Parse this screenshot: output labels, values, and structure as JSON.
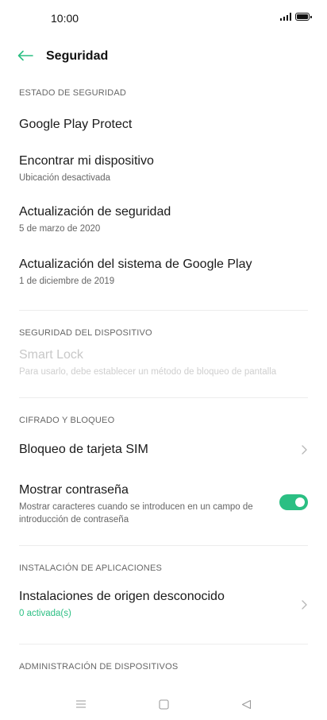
{
  "status": {
    "time": "10:00"
  },
  "header": {
    "title": "Seguridad"
  },
  "sections": {
    "security_status": {
      "header": "ESTADO DE SEGURIDAD",
      "items": [
        {
          "title": "Google Play Protect"
        },
        {
          "title": "Encontrar mi dispositivo",
          "subtitle": "Ubicación desactivada"
        },
        {
          "title": "Actualización de seguridad",
          "subtitle": "5 de marzo de 2020"
        },
        {
          "title": "Actualización del sistema de Google Play",
          "subtitle": "1 de diciembre de 2019"
        }
      ]
    },
    "device_security": {
      "header": "SEGURIDAD DEL DISPOSITIVO",
      "items": [
        {
          "title": "Smart Lock",
          "subtitle": "Para usarlo, debe establecer un método de bloqueo de pantalla"
        }
      ]
    },
    "encryption": {
      "header": "CIFRADO Y BLOQUEO",
      "items": [
        {
          "title": "Bloqueo de tarjeta SIM"
        },
        {
          "title": "Mostrar contraseña",
          "subtitle": "Mostrar caracteres cuando se introducen en un campo de introducción de contraseña",
          "toggle_on": true
        }
      ]
    },
    "app_install": {
      "header": "INSTALACIÓN DE APLICACIONES",
      "items": [
        {
          "title": "Instalaciones de origen desconocido",
          "subtitle": "0 activada(s)"
        }
      ]
    },
    "device_admin": {
      "header": "ADMINISTRACIÓN DE DISPOSITIVOS"
    }
  },
  "colors": {
    "accent": "#2bbf83"
  }
}
